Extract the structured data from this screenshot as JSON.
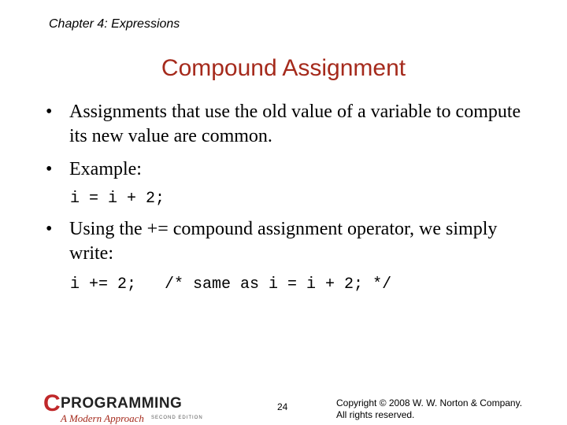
{
  "header": {
    "chapter": "Chapter 4: Expressions"
  },
  "slide": {
    "title": "Compound Assignment",
    "bullets": [
      {
        "marker": "•",
        "text": "Assignments that use the old value of a variable to compute its new value are common."
      },
      {
        "marker": "•",
        "text": "Example:"
      },
      {
        "marker": "•",
        "text": "Using the += compound assignment operator, we simply write:"
      }
    ],
    "code": [
      "i = i + 2;",
      "i += 2;   /* same as i = i + 2; */"
    ]
  },
  "footer": {
    "logo": {
      "letter": "C",
      "word": "PROGRAMMING",
      "subtitle": "A Modern Approach",
      "edition": "SECOND EDITION"
    },
    "page_number": "24",
    "copyright_line1": "Copyright © 2008 W. W. Norton & Company.",
    "copyright_line2": "All rights reserved."
  }
}
